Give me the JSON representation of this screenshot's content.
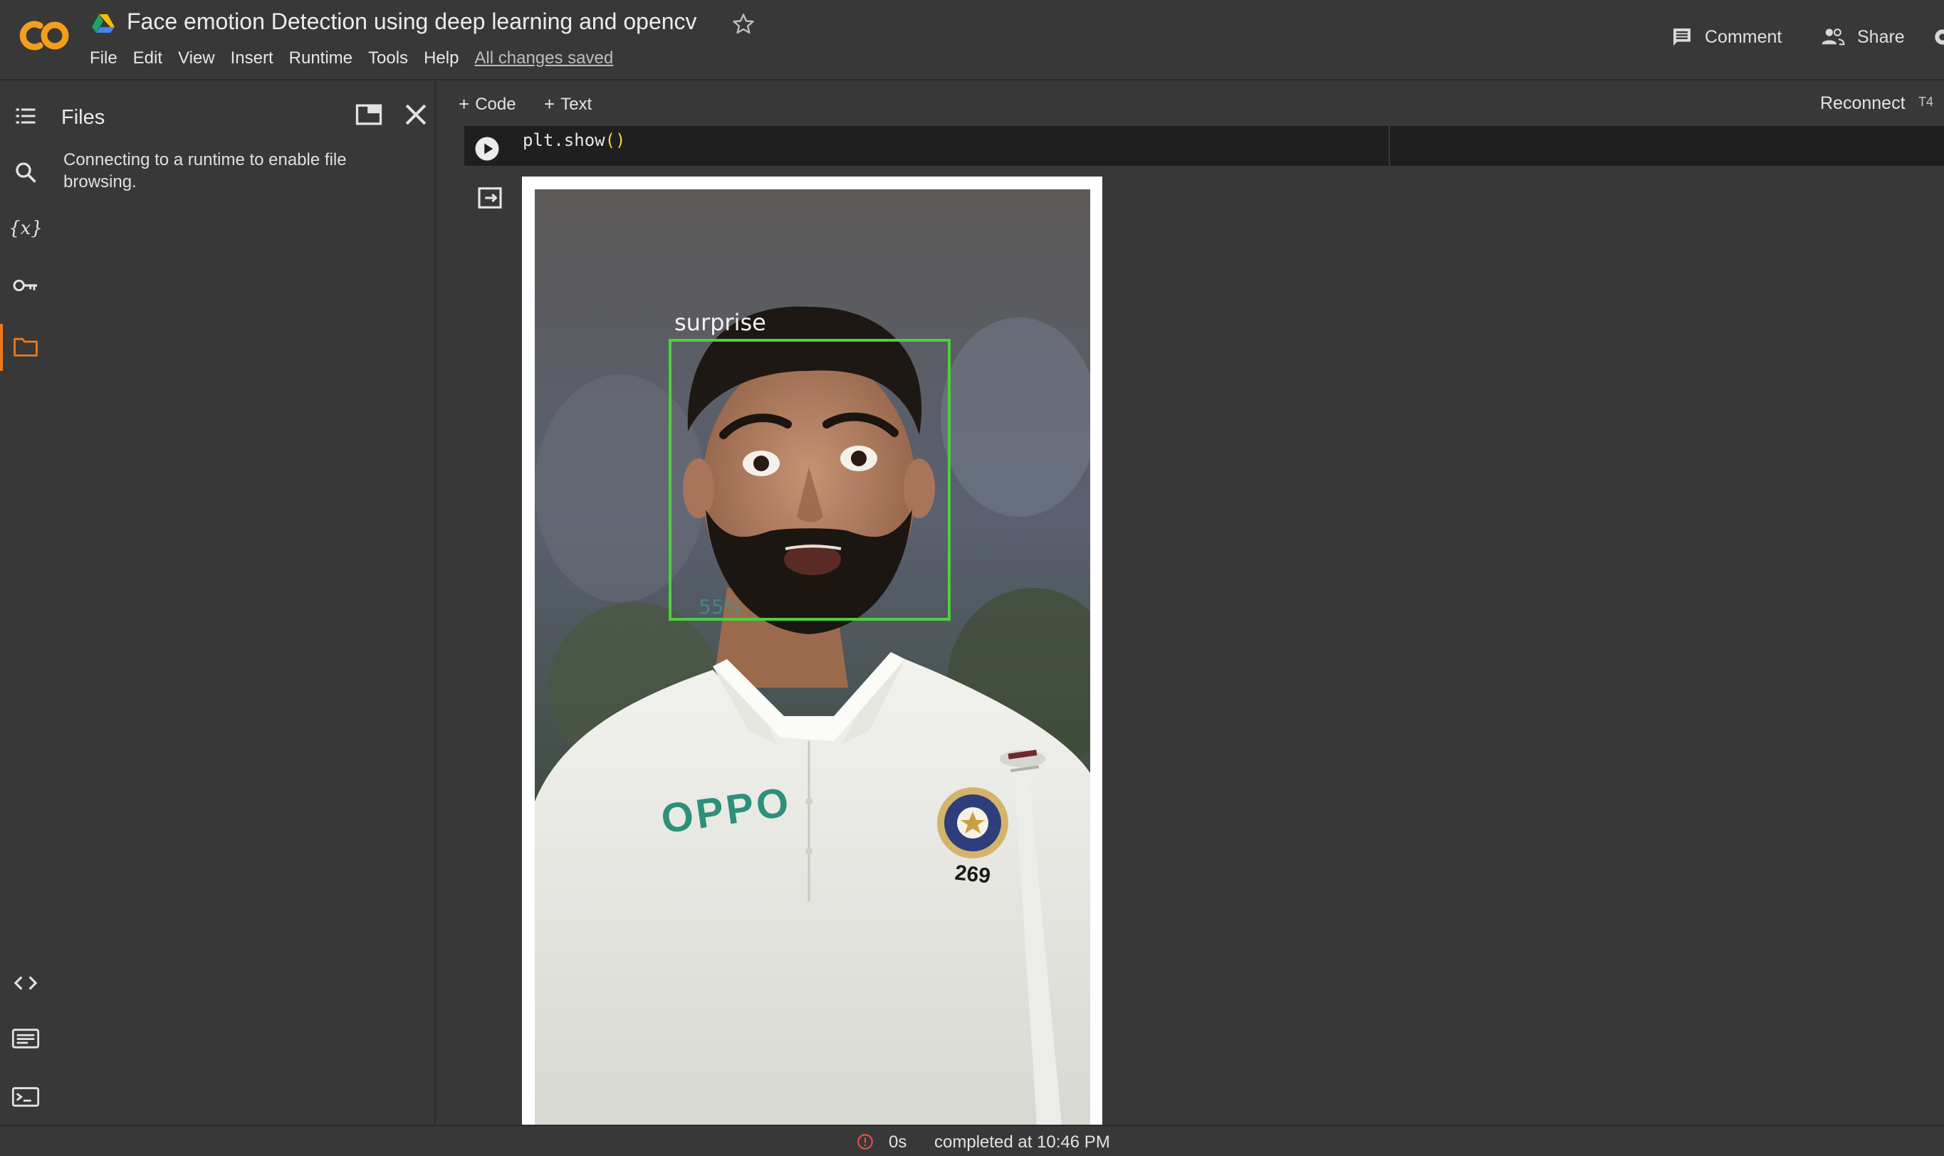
{
  "header": {
    "title": "Face emotion Detection using deep learning and opencv",
    "logo": "colab-logo",
    "menu": [
      "File",
      "Edit",
      "View",
      "Insert",
      "Runtime",
      "Tools",
      "Help"
    ],
    "saved_status": "All changes saved",
    "comment_label": "Comment",
    "share_label": "Share"
  },
  "rail": {
    "icons": [
      "table-of-contents-icon",
      "search-icon",
      "variables-icon",
      "key-icon",
      "folder-icon",
      "code-snippets-icon",
      "command-palette-icon",
      "terminal-icon"
    ],
    "active": "folder-icon",
    "accent_color": "#ef7a1a"
  },
  "files_panel": {
    "title": "Files",
    "message": "Connecting to a runtime to enable file browsing."
  },
  "toolbar": {
    "add_code_label": "Code",
    "add_text_label": "Text",
    "reconnect_label": "Reconnect",
    "runtime_type": "T4"
  },
  "cell": {
    "code_prefix": "plt.show",
    "code_parens": "()"
  },
  "output": {
    "emotion_label": "surprise",
    "confidence": "55%",
    "box_color": "#4cd03c",
    "jersey_text": "OPPO",
    "jersey_number": "269"
  },
  "status": {
    "duration": "0s",
    "completed": "completed at 10:46 PM"
  }
}
